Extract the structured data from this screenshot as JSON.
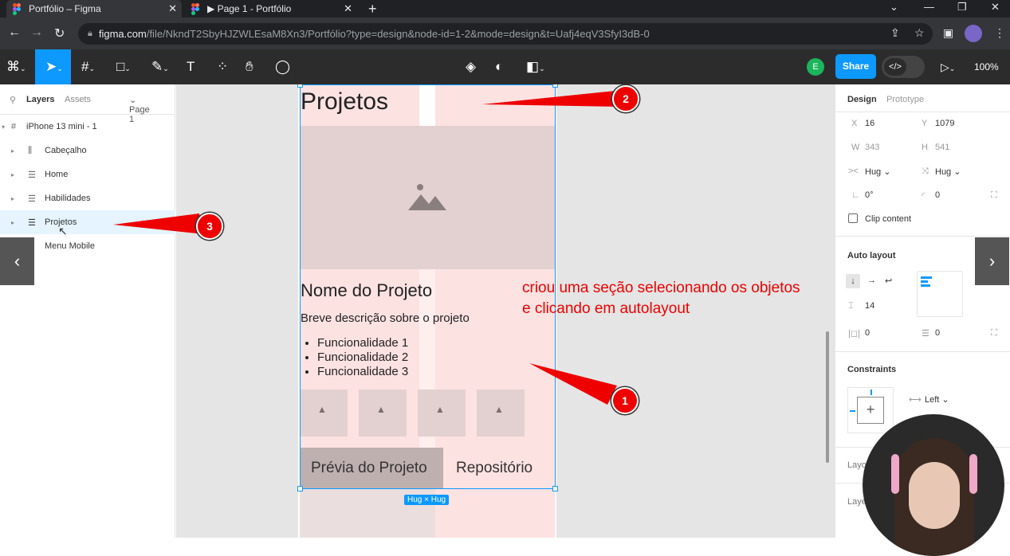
{
  "browser": {
    "tabs": [
      {
        "label": "Portfólio – Figma"
      },
      {
        "label": "▶ Page 1 - Portfólio"
      }
    ],
    "url_host": "figma.com",
    "url_path": "/file/NkndT2SbyHJZWLEsaM8Xn3/Portfólio?type=design&node-id=1-2&mode=design&t=Uafj4eqV3SfyI3dB-0"
  },
  "toolbar": {
    "avatar_initial": "E",
    "share_label": "Share",
    "zoom": "100%"
  },
  "left_panel": {
    "tab_layers": "Layers",
    "tab_assets": "Assets",
    "page_selector": "Page 1",
    "frame_name": "iPhone 13 mini - 1",
    "layers": [
      {
        "label": "Cabeçalho"
      },
      {
        "label": "Home"
      },
      {
        "label": "Habilidades"
      },
      {
        "label": "Projetos"
      },
      {
        "label": "Menu Mobile"
      }
    ]
  },
  "canvas": {
    "title": "Projetos",
    "project_name": "Nome do Projeto",
    "project_desc": "Breve descrição sobre o projeto",
    "features": [
      "Funcionalidade 1",
      "Funcionalidade 2",
      "Funcionalidade 3"
    ],
    "btn_preview": "Prévia do Projeto",
    "btn_repo": "Repositório",
    "hug_tag": "Hug × Hug"
  },
  "right_panel": {
    "tab_design": "Design",
    "tab_prototype": "Prototype",
    "x_label": "X",
    "x_value": "16",
    "y_label": "Y",
    "y_value": "1079",
    "w_label": "W",
    "w_value": "343",
    "h_label": "H",
    "h_value": "541",
    "width_mode": "Hug",
    "height_mode": "Hug",
    "rotation": "0°",
    "radius": "0",
    "clip_content": "Clip content",
    "auto_layout": "Auto layout",
    "gap": "14",
    "padding_h": "0",
    "padding_v": "0",
    "constraints": "Constraints",
    "constraint_h": "Left",
    "cut_layout": "Layo",
    "cut_layer": "Laye"
  },
  "annotations": {
    "badge1": "1",
    "badge2": "2",
    "badge3": "3",
    "note_line1": "criou uma seção selecionando os objetos",
    "note_line2": "e clicando em autolayout"
  },
  "colors": {
    "accent": "#0d99ff",
    "annotation": "#ee0000"
  }
}
